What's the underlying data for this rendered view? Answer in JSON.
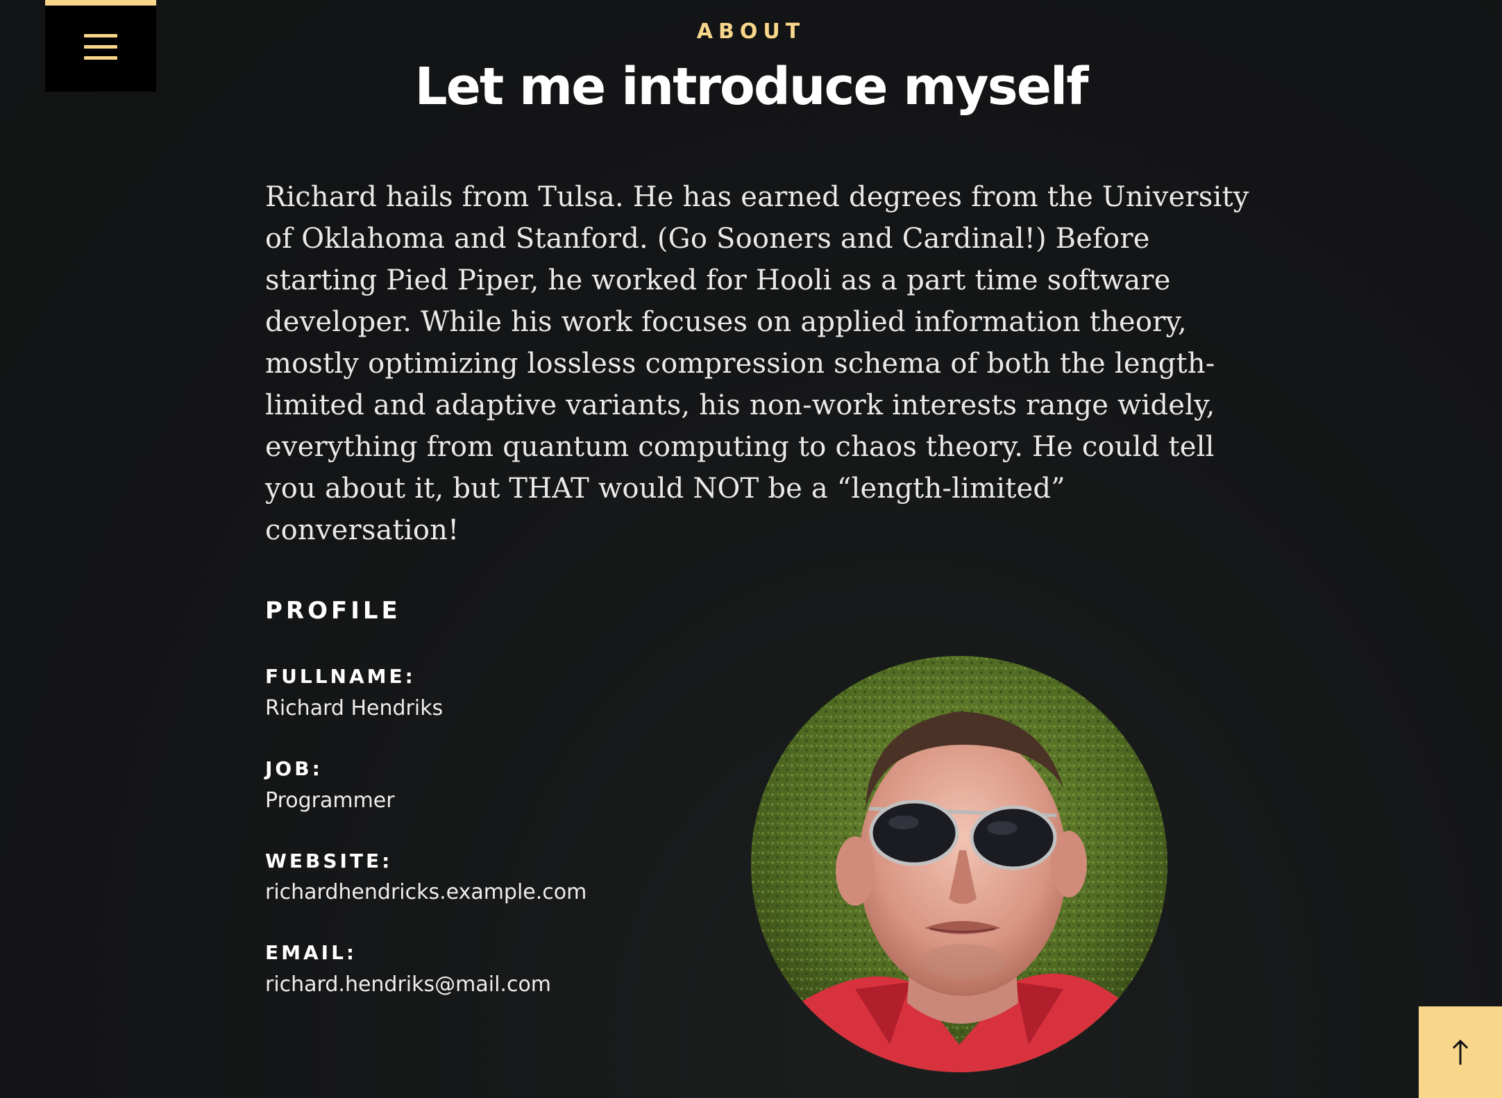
{
  "header": {
    "section_label": "ABOUT",
    "title": "Let me introduce myself"
  },
  "intro": {
    "text": "Richard hails from Tulsa. He has earned degrees from the University of Oklahoma and Stanford. (Go Sooners and Cardinal!) Before starting Pied Piper, he worked for Hooli as a part time software developer. While his work focuses on applied information theory, mostly optimizing lossless compression schema of both the length-limited and adaptive variants, his non-work interests range widely, everything from quantum computing to chaos theory. He could tell you about it, but THAT would NOT be a “length-limited” conversation!"
  },
  "profile": {
    "heading": "PROFILE",
    "fields": [
      {
        "label": "FULLNAME:",
        "value": "Richard Hendriks"
      },
      {
        "label": "JOB:",
        "value": "Programmer"
      },
      {
        "label": "WEBSITE:",
        "value": "richardhendricks.example.com"
      },
      {
        "label": "EMAIL:",
        "value": "richard.hendriks@mail.com"
      }
    ]
  },
  "icons": {
    "menu": "hamburger-menu-icon",
    "back_to_top": "arrow-up-icon"
  },
  "colors": {
    "accent": "#f8d68a",
    "background": "#141516",
    "text": "#ffffff"
  }
}
